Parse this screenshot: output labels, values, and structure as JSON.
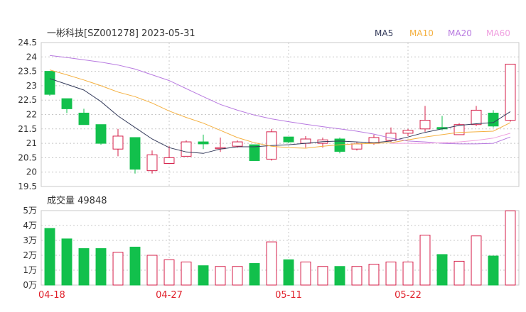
{
  "header": {
    "title": "一彬科技[SZ001278] 2023-05-31",
    "legend": [
      {
        "label": "MA5",
        "color": "#333a5a"
      },
      {
        "label": "MA10",
        "color": "#f4b040"
      },
      {
        "label": "MA20",
        "color": "#b87ae0"
      },
      {
        "label": "MA60",
        "color": "#f0a0e0"
      }
    ]
  },
  "volume_label": "成交量 49848",
  "colors": {
    "up": "#d6204a",
    "down": "#12c04c",
    "ma5": "#333a5a",
    "ma10": "#f4b040",
    "ma20": "#b87ae0",
    "ma60": "#f0a0e0",
    "grid": "#c8c8c8",
    "axis_text": "#333333",
    "date_text": "#e0202a"
  },
  "chart_data": {
    "type": "candlestick",
    "price_axis": {
      "range": [
        19.5,
        24.5
      ],
      "ticks": [
        "24.5",
        "24",
        "23.5",
        "23",
        "22.5",
        "22",
        "21.5",
        "21",
        "20.5",
        "20",
        "19.5"
      ]
    },
    "volume_axis": {
      "range": [
        0,
        50000
      ],
      "ticks": [
        "5万",
        "4万",
        "3万",
        "2万",
        "1万",
        "0万"
      ]
    },
    "date_labels": [
      {
        "label": "04-18",
        "index": 0
      },
      {
        "label": "04-27",
        "index": 7
      },
      {
        "label": "05-11",
        "index": 14
      },
      {
        "label": "05-22",
        "index": 21
      }
    ],
    "candles": [
      {
        "o": 23.5,
        "c": 22.7,
        "h": 23.5,
        "l": 22.65,
        "v": 38000
      },
      {
        "o": 22.55,
        "c": 22.2,
        "h": 22.55,
        "l": 22.05,
        "v": 31000
      },
      {
        "o": 22.05,
        "c": 21.65,
        "h": 22.2,
        "l": 21.65,
        "v": 24500
      },
      {
        "o": 21.65,
        "c": 21.0,
        "h": 21.65,
        "l": 20.95,
        "v": 24500
      },
      {
        "o": 20.8,
        "c": 21.25,
        "h": 21.5,
        "l": 20.55,
        "v": 22000
      },
      {
        "o": 21.2,
        "c": 20.1,
        "h": 21.2,
        "l": 19.95,
        "v": 25500
      },
      {
        "o": 20.05,
        "c": 20.6,
        "h": 20.75,
        "l": 19.95,
        "v": 20000
      },
      {
        "o": 20.3,
        "c": 20.5,
        "h": 20.9,
        "l": 20.3,
        "v": 17000
      },
      {
        "o": 20.55,
        "c": 21.05,
        "h": 21.1,
        "l": 20.55,
        "v": 15500
      },
      {
        "o": 21.05,
        "c": 20.98,
        "h": 21.3,
        "l": 20.8,
        "v": 13000
      },
      {
        "o": 20.85,
        "c": 20.85,
        "h": 21.2,
        "l": 20.7,
        "v": 12500
      },
      {
        "o": 20.9,
        "c": 21.05,
        "h": 21.1,
        "l": 20.85,
        "v": 12500
      },
      {
        "o": 20.95,
        "c": 20.4,
        "h": 20.95,
        "l": 20.4,
        "v": 14500
      },
      {
        "o": 20.45,
        "c": 21.4,
        "h": 21.5,
        "l": 20.4,
        "v": 29000
      },
      {
        "o": 21.22,
        "c": 21.05,
        "h": 21.22,
        "l": 21.0,
        "v": 17000
      },
      {
        "o": 21.0,
        "c": 21.15,
        "h": 21.25,
        "l": 20.85,
        "v": 15500
      },
      {
        "o": 21.0,
        "c": 21.12,
        "h": 21.2,
        "l": 20.85,
        "v": 12500
      },
      {
        "o": 21.15,
        "c": 20.72,
        "h": 21.2,
        "l": 20.65,
        "v": 12500
      },
      {
        "o": 20.8,
        "c": 20.98,
        "h": 21.05,
        "l": 20.75,
        "v": 12500
      },
      {
        "o": 21.0,
        "c": 21.2,
        "h": 21.3,
        "l": 20.95,
        "v": 14000
      },
      {
        "o": 21.1,
        "c": 21.35,
        "h": 21.55,
        "l": 21.05,
        "v": 15500
      },
      {
        "o": 21.35,
        "c": 21.45,
        "h": 21.5,
        "l": 21.25,
        "v": 15500
      },
      {
        "o": 21.5,
        "c": 21.8,
        "h": 22.3,
        "l": 21.4,
        "v": 33500
      },
      {
        "o": 21.55,
        "c": 21.5,
        "h": 21.95,
        "l": 21.45,
        "v": 20500
      },
      {
        "o": 21.3,
        "c": 21.65,
        "h": 21.7,
        "l": 21.3,
        "v": 16000
      },
      {
        "o": 21.65,
        "c": 22.15,
        "h": 22.3,
        "l": 21.6,
        "v": 33000
      },
      {
        "o": 22.05,
        "c": 21.6,
        "h": 22.15,
        "l": 21.55,
        "v": 19500
      },
      {
        "o": 21.8,
        "c": 23.75,
        "h": 23.75,
        "l": 21.75,
        "v": 49848
      }
    ],
    "ma": {
      "MA5": [
        23.25,
        23.05,
        22.85,
        22.45,
        21.95,
        21.55,
        21.15,
        20.85,
        20.7,
        20.65,
        20.8,
        20.88,
        20.88,
        20.92,
        20.95,
        21.0,
        21.06,
        21.08,
        21.05,
        21.02,
        21.08,
        21.22,
        21.38,
        21.5,
        21.62,
        21.68,
        21.72,
        22.1
      ],
      "MA10": [
        23.55,
        23.38,
        23.2,
        23.0,
        22.78,
        22.62,
        22.4,
        22.12,
        21.9,
        21.7,
        21.45,
        21.2,
        21.02,
        20.9,
        20.85,
        20.83,
        20.9,
        20.95,
        20.98,
        21.0,
        21.02,
        21.12,
        21.22,
        21.3,
        21.38,
        21.4,
        21.42,
        21.72
      ],
      "MA20": [
        24.05,
        23.98,
        23.9,
        23.82,
        23.72,
        23.58,
        23.38,
        23.18,
        22.9,
        22.62,
        22.35,
        22.15,
        21.98,
        21.85,
        21.75,
        21.66,
        21.58,
        21.5,
        21.42,
        21.32,
        21.18,
        21.08,
        21.05,
        21.0,
        20.98,
        20.98,
        21.0,
        21.22
      ],
      "MA60": [
        null,
        null,
        null,
        null,
        null,
        null,
        null,
        null,
        null,
        null,
        null,
        null,
        null,
        null,
        null,
        null,
        null,
        null,
        null,
        null,
        21.0,
        21.0,
        21.0,
        21.02,
        21.05,
        21.1,
        21.18,
        21.35
      ]
    }
  }
}
